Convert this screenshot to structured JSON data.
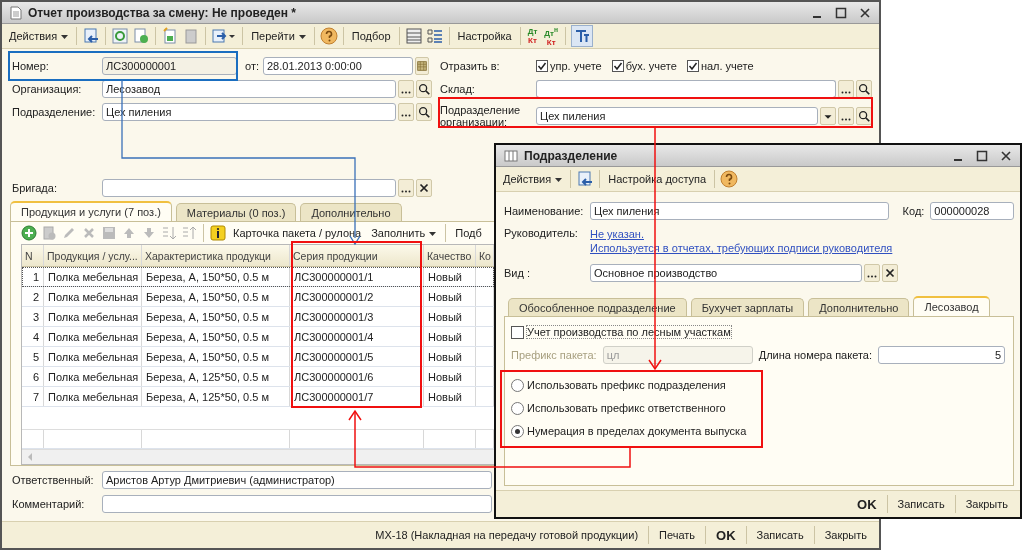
{
  "main_window": {
    "title": "Отчет производства за смену: Не проведен *",
    "toolbar": {
      "actions": "Действия",
      "goto": "Перейти",
      "pick": "Подбор",
      "settings": "Настройка",
      "dt_kt": [
        {
          "top": "Дт",
          "bottom": "Кт"
        },
        {
          "top": "Дт$^{н}$",
          "bottom": "Кт"
        }
      ]
    },
    "number": {
      "label": "Номер:",
      "value": "ЛС300000001"
    },
    "date": {
      "label": "от:",
      "value": "28.01.2013  0:00:00"
    },
    "organization": {
      "label": "Организация:",
      "value": "Лесозавод"
    },
    "department": {
      "label": "Подразделение:",
      "value": "Цех пиления"
    },
    "reflect": {
      "label": "Отразить в:",
      "options": [
        {
          "label": "упр. учете",
          "checked": true
        },
        {
          "label": "бух. учете",
          "checked": true
        },
        {
          "label": "нал. учете",
          "checked": true
        }
      ]
    },
    "warehouse": {
      "label": "Склад:"
    },
    "org_department": {
      "label": "Подразделение организации:",
      "value": "Цех пиления"
    },
    "brigade": {
      "label": "Бригада:"
    },
    "tabs": [
      {
        "label": "Продукция и услуги (7 поз.)",
        "selected": true
      },
      {
        "label": "Материалы (0 поз.)",
        "selected": false
      },
      {
        "label": "Дополнительно",
        "selected": false
      }
    ],
    "table_toolbar": {
      "card": "Карточка пакета / рулона",
      "fill": "Заполнить",
      "pick": "Подб"
    },
    "table": {
      "columns": [
        "N",
        "Продукция / услу...",
        "Характеристика продукци",
        "Серия продукции",
        "Качество",
        "Ко"
      ],
      "rows": [
        {
          "n": "1",
          "product": "Полка мебельная",
          "feature": "Береза, А, 150*50, 0.5 м",
          "series": "ЛС300000001/1",
          "quality": "Новый",
          "selected": true
        },
        {
          "n": "2",
          "product": "Полка мебельная",
          "feature": "Береза, А, 150*50, 0.5 м",
          "series": "ЛС300000001/2",
          "quality": "Новый",
          "selected": false
        },
        {
          "n": "3",
          "product": "Полка мебельная",
          "feature": "Береза, А, 150*50, 0.5 м",
          "series": "ЛС300000001/3",
          "quality": "Новый",
          "selected": false
        },
        {
          "n": "4",
          "product": "Полка мебельная",
          "feature": "Береза, А, 150*50, 0.5 м",
          "series": "ЛС300000001/4",
          "quality": "Новый",
          "selected": false
        },
        {
          "n": "5",
          "product": "Полка мебельная",
          "feature": "Береза, А, 150*50, 0.5 м",
          "series": "ЛС300000001/5",
          "quality": "Новый",
          "selected": false
        },
        {
          "n": "6",
          "product": "Полка мебельная",
          "feature": "Береза, А, 125*50, 0.5 м",
          "series": "ЛС300000001/6",
          "quality": "Новый",
          "selected": false
        },
        {
          "n": "7",
          "product": "Полка мебельная",
          "feature": "Береза, А, 125*50, 0.5 м",
          "series": "ЛС300000001/7",
          "quality": "Новый",
          "selected": false
        }
      ]
    },
    "responsible": {
      "label": "Ответственный:",
      "value": "Аристов Артур Дмитриевич (администратор)"
    },
    "comment": {
      "label": "Комментарий:"
    },
    "footer": {
      "form": "МХ-18 (Накладная на передачу готовой продукции)",
      "buttons": [
        {
          "label": "Печать",
          "kind": "normal"
        },
        {
          "label": "OK",
          "kind": "default"
        },
        {
          "label": "Записать",
          "kind": "normal"
        },
        {
          "label": "Закрыть",
          "kind": "normal"
        }
      ]
    }
  },
  "dept_window": {
    "title": "Подразделение",
    "toolbar": {
      "actions": "Действия",
      "access": "Настройка доступа"
    },
    "name": {
      "label": "Наименование:",
      "value": "Цех пиления"
    },
    "code": {
      "label": "Код:",
      "value": "000000028"
    },
    "head": {
      "label": "Руководитель:",
      "links": [
        "Не указан.",
        "Используется в отчетах, требующих подписи руководителя"
      ]
    },
    "kind": {
      "label": "Вид :",
      "value": "Основное производство"
    },
    "tabs": [
      {
        "label": "Обособленное подразделение",
        "selected": false
      },
      {
        "label": "Бухучет зарплаты",
        "selected": false
      },
      {
        "label": "Дополнительно",
        "selected": false
      },
      {
        "label": "Лесозавод",
        "selected": true
      }
    ],
    "forest_accounting": {
      "label": "Учет производства по лесным участкам",
      "checked": false
    },
    "prefix": {
      "label": "Префикс пакета:",
      "value": "цл",
      "disabled": true
    },
    "length": {
      "label": "Длина номера пакета:",
      "value": "5"
    },
    "numbering": [
      {
        "label": "Использовать префикс подразделения",
        "selected": false
      },
      {
        "label": "Использовать префикс ответственного",
        "selected": false
      },
      {
        "label": "Нумерация в пределах документа выпуска",
        "selected": true
      }
    ],
    "buttons": [
      {
        "label": "OK",
        "kind": "default"
      },
      {
        "label": "Записать",
        "kind": "normal"
      },
      {
        "label": "Закрыть",
        "kind": "normal"
      }
    ]
  }
}
